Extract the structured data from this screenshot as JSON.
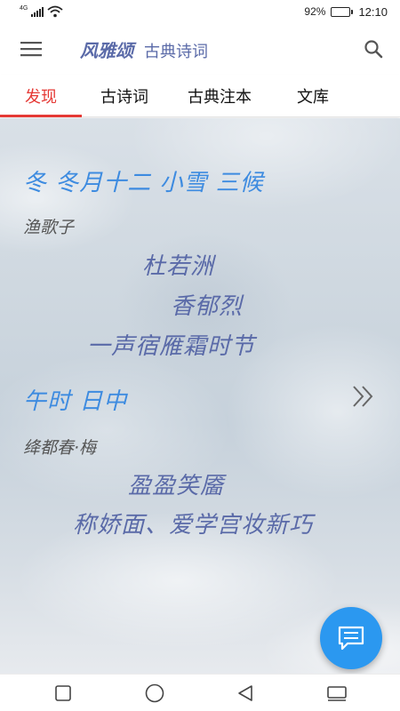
{
  "status_bar": {
    "network": "4G",
    "battery_percent": "92%",
    "battery_level": 0.92,
    "time": "12:10"
  },
  "app_bar": {
    "title": "风雅颂",
    "subtitle": "古典诗词",
    "menu_icon": "hamburger-menu-icon",
    "search_icon": "search-icon"
  },
  "tabs": [
    {
      "label": "发现",
      "active": true
    },
    {
      "label": "古诗词",
      "active": false
    },
    {
      "label": "古典注本",
      "active": false
    },
    {
      "label": "文库",
      "active": false
    }
  ],
  "main": {
    "term_heading": "冬  冬月十二  小雪  三候",
    "poem1": {
      "title": "渔歌子",
      "lines": [
        "杜若洲",
        "香郁烈",
        "一声宿雁霜时节"
      ]
    },
    "time_heading": "午时  日中",
    "next_icon": "double-chevron-right-icon",
    "poem2": {
      "title": "绛都春·梅",
      "lines": [
        "盈盈笑靥",
        "称娇面、爱学宫妆新巧"
      ]
    }
  },
  "fab": {
    "icon": "message-icon",
    "color": "#2b98f0"
  },
  "nav_bar": {
    "icons": [
      "recent-apps-icon",
      "home-icon",
      "back-icon",
      "notification-shade-icon"
    ]
  },
  "colors": {
    "accent_red": "#e53935",
    "heading_blue": "#3d8be0",
    "poem_indigo": "#5a6aa8"
  }
}
